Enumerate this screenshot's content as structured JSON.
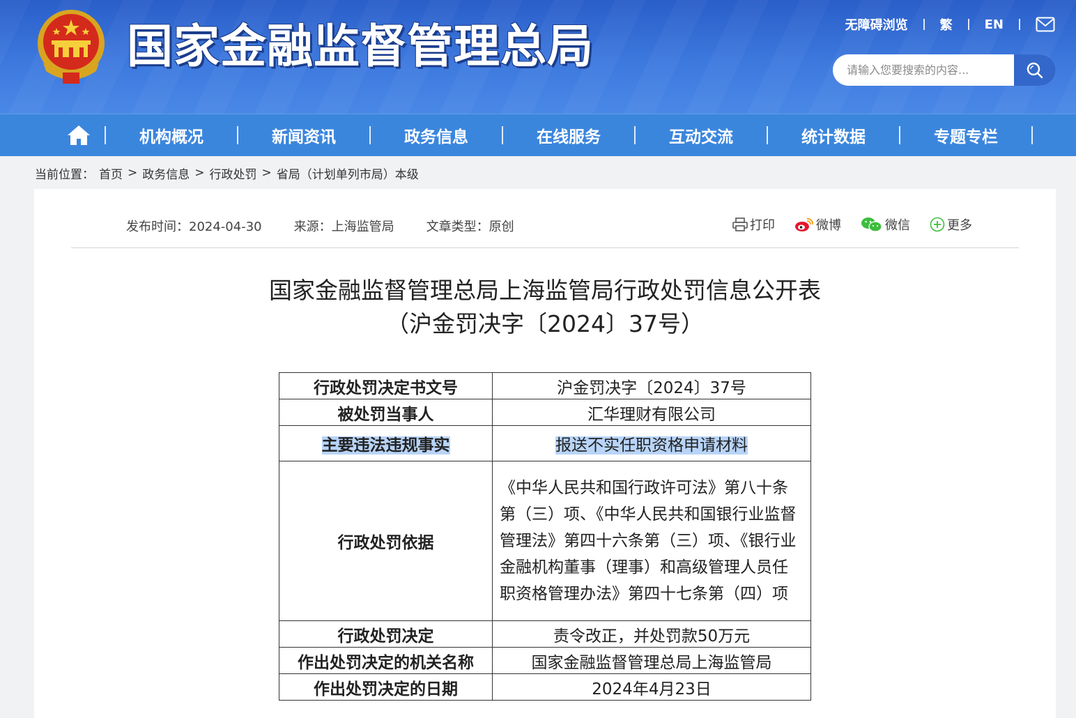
{
  "header": {
    "site_title": "国家金融监督管理总局",
    "accessibility": "无障碍浏览",
    "traditional": "繁",
    "english": "EN",
    "search_placeholder": "请输入您要搜索的内容..."
  },
  "nav": {
    "items": [
      "机构概况",
      "新闻资讯",
      "政务信息",
      "在线服务",
      "互动交流",
      "统计数据",
      "专题专栏"
    ]
  },
  "breadcrumb": {
    "label": "当前位置：",
    "items": [
      "首页",
      "政务信息",
      "行政处罚",
      "省局（计划单列市局）本级"
    ],
    "separator": ">"
  },
  "article": {
    "publish_time": "发布时间：2024-04-30",
    "source": "来源：上海监管局",
    "type": "文章类型：原创",
    "share": {
      "print": "打印",
      "weibo": "微博",
      "wechat": "微信",
      "more": "更多"
    },
    "title_line1": "国家金融监督管理总局上海监管局行政处罚信息公开表",
    "title_line2": "（沪金罚决字〔2024〕37号）"
  },
  "table": {
    "rows": [
      {
        "key": "行政处罚决定书文号",
        "value": "沪金罚决字〔2024〕37号"
      },
      {
        "key": "被处罚当事人",
        "value": "汇华理财有限公司"
      },
      {
        "key": "主要违法违规事实",
        "value": "报送不实任职资格申请材料"
      },
      {
        "key": "行政处罚依据",
        "value": "《中华人民共和国行政许可法》第八十条第（三）项、《中华人民共和国银行业监督管理法》第四十六条第（三）项、《银行业金融机构董事（理事）和高级管理人员任职资格管理办法》第四十七条第（四）项"
      },
      {
        "key": "行政处罚决定",
        "value": "责令改正，并处罚款50万元"
      },
      {
        "key": "作出处罚决定的机关名称",
        "value": "国家金融监督管理总局上海监管局"
      },
      {
        "key": "作出处罚决定的日期",
        "value": "2024年4月23日"
      }
    ]
  },
  "colors": {
    "header_blue": "#3d79de",
    "nav_blue": "#3b86dd",
    "highlight": "#b8d4f8"
  }
}
